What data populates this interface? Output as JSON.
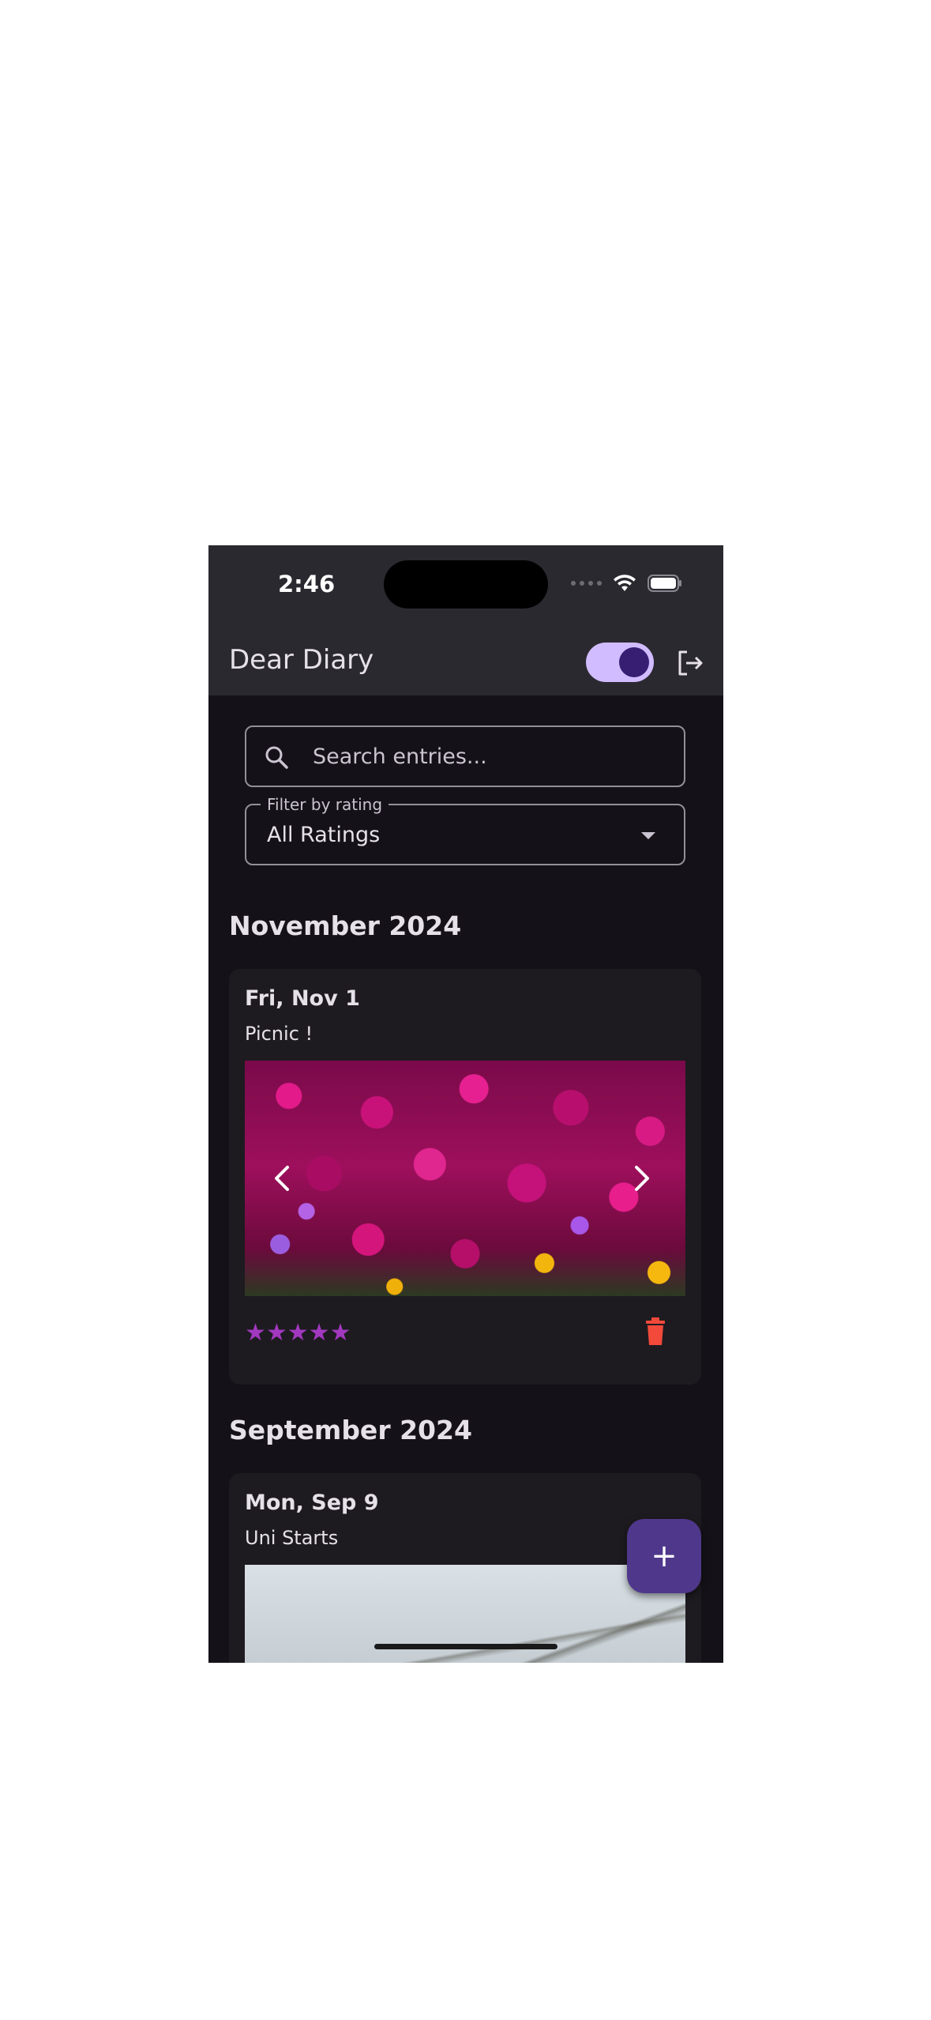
{
  "status_bar": {
    "time": "2:46"
  },
  "app_bar": {
    "title": "Dear Diary",
    "theme_toggle_on": true
  },
  "search": {
    "placeholder": "Search entries..."
  },
  "filter": {
    "label": "Filter by rating",
    "selected": "All Ratings"
  },
  "sections": [
    {
      "month": "November 2024",
      "entries": [
        {
          "date": "Fri, Nov 1",
          "title": "Picnic !",
          "rating": 5,
          "stars": "★★★★★"
        }
      ]
    },
    {
      "month": "September 2024",
      "entries": [
        {
          "date": "Mon, Sep 9",
          "title": "Uni Starts"
        }
      ]
    }
  ],
  "fab": {
    "label": "+"
  },
  "colors": {
    "background": "#141218",
    "surface": "#1d1b20",
    "app_bar": "#2b2930",
    "accent": "#d0bcff",
    "fab": "#4f378b",
    "star": "#a238c0",
    "delete": "#f2493a"
  },
  "icons": {
    "search": "search-icon",
    "logout": "logout-icon",
    "dropdown": "arrow-drop-down-icon",
    "prev": "chevron-left-icon",
    "next": "chevron-right-icon",
    "delete": "trash-icon",
    "add": "plus-icon"
  }
}
